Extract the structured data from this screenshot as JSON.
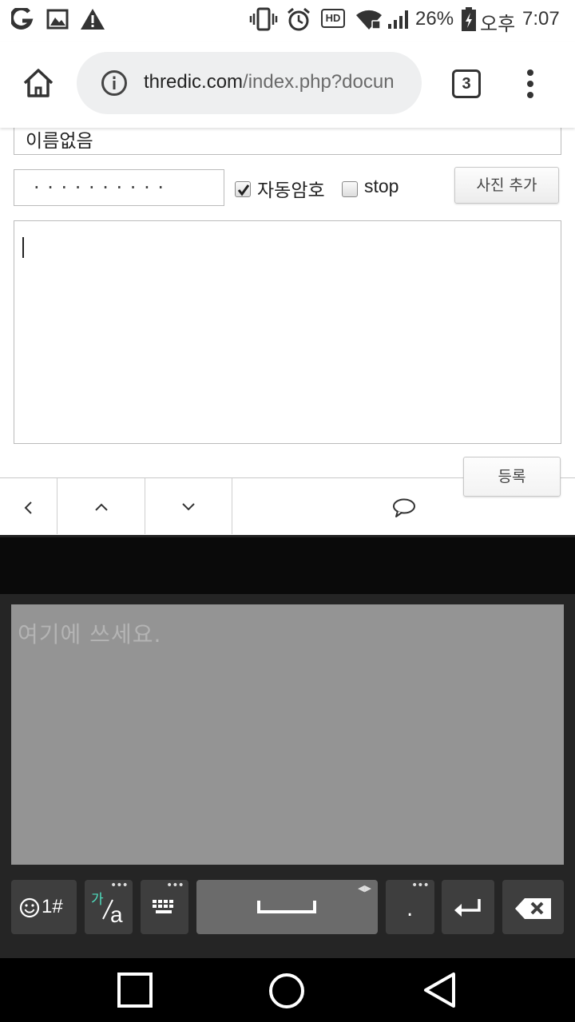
{
  "status_bar": {
    "battery_percent": "26%",
    "ampm": "오후",
    "time": "7:07",
    "hd_label": "HD",
    "icons": [
      "g-app-icon",
      "gallery-icon",
      "warning-icon",
      "vibrate-icon",
      "alarm-icon",
      "hd-voice-icon",
      "wifi-icon",
      "signal-icon",
      "battery-icon"
    ]
  },
  "browser": {
    "url_domain": "thredic.com",
    "url_path": "/index.php?docun",
    "tab_count": "3",
    "icons": [
      "home-icon",
      "info-icon",
      "more-vert-icon"
    ]
  },
  "form": {
    "name_value": "이름없음",
    "password_mask": "· · · · · · · · · ·",
    "auto_password_label": "자동암호",
    "auto_password_checked": true,
    "stop_label": "stop",
    "stop_checked": false,
    "add_photo_label": "사진 추가",
    "submit_label": "등록",
    "body_value": ""
  },
  "nav_toolbar": {
    "icons": [
      "chevron-left-icon",
      "chevron-up-icon",
      "chevron-down-icon",
      "comment-icon"
    ]
  },
  "keyboard": {
    "handwriting_placeholder": "여기에 쓰세요.",
    "emoji_key_label": "1#",
    "lang_key_ko": "가",
    "lang_key_en": "a",
    "period_key_label": ".",
    "accent_color": "#4fe0c0",
    "icons": [
      "emoji-icon",
      "keyboard-icon",
      "space-icon",
      "enter-icon",
      "backspace-icon"
    ]
  },
  "system_nav": {
    "icons": [
      "recent-apps-icon",
      "home-circle-icon",
      "back-triangle-icon"
    ]
  }
}
